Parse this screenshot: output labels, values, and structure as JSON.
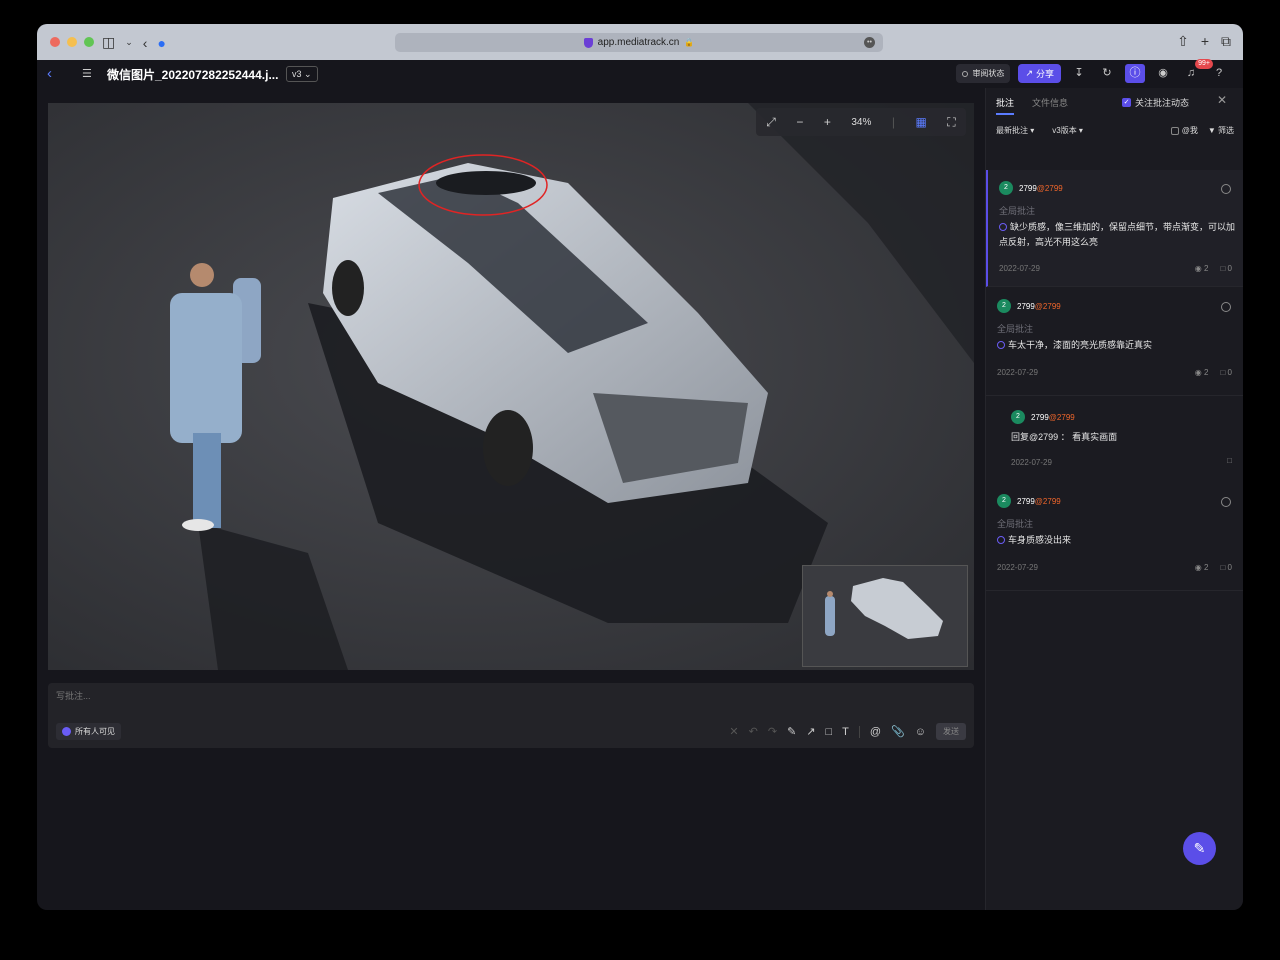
{
  "browser": {
    "url": "app.mediatrack.cn"
  },
  "header": {
    "file_title": "微信图片_202207282252444.j...",
    "version": "v3",
    "review_label": "审阅状态",
    "share_label": "分享",
    "notif_badge": "99+",
    "help_label": "?"
  },
  "viewer": {
    "zoom": "34%"
  },
  "composer": {
    "placeholder": "写批注...",
    "visibility_label": "所有人可见",
    "text_tool": "T",
    "at_tool": "@",
    "send_label": "发送"
  },
  "panel": {
    "tab_comments": "批注",
    "tab_fileinfo": "文件信息",
    "follow_label": "关注批注动态",
    "sort_label": "最新批注",
    "version_filter": "v3版本",
    "at_me_label": "@我",
    "filter_label": "筛选"
  },
  "comments": [
    {
      "avatar": "2",
      "author": "2799",
      "mention": "@2799",
      "scope": "全局批注",
      "text": "缺少质感，像三维加的，保留点细节，带点渐变，可以加点反射，高光不用这么亮",
      "date": "2022-07-29",
      "views": "2",
      "replies": "0"
    },
    {
      "avatar": "2",
      "author": "2799",
      "mention": "@2799",
      "scope": "全局批注",
      "text": "车太干净，漆面的亮光质感靠近真实",
      "date": "2022-07-29",
      "views": "2",
      "replies": "0"
    },
    {
      "avatar": "2",
      "author": "2799",
      "mention": "@2799",
      "text": "回复@2799 ： 看真实画面",
      "date": "2022-07-29"
    },
    {
      "avatar": "2",
      "author": "2799",
      "mention": "@2799",
      "scope": "全局批注",
      "text": "车身质感没出来",
      "date": "2022-07-29",
      "views": "2",
      "replies": "0"
    }
  ],
  "colors": {
    "accent": "#5b4ee8",
    "link": "#5b7cff",
    "mention": "#f0662b",
    "annotation": "#e02424"
  }
}
